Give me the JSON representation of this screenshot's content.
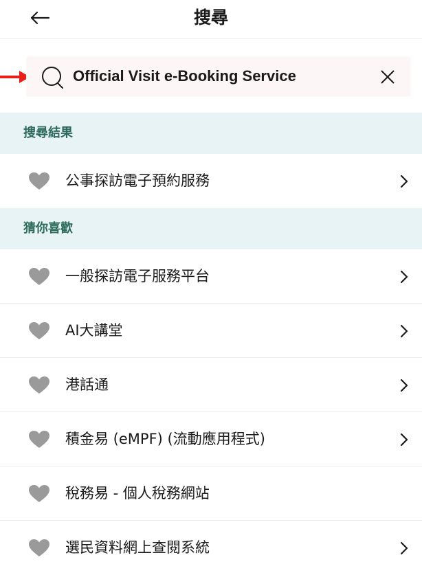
{
  "header": {
    "title": "搜尋"
  },
  "search": {
    "value": "Official Visit e-Booking Service"
  },
  "sections": {
    "results": {
      "title": "搜尋結果",
      "items": [
        {
          "label": "公事探訪電子預約服務"
        }
      ]
    },
    "recommended": {
      "title": "猜你喜歡",
      "items": [
        {
          "label": "一般探訪電子服務平台"
        },
        {
          "label": "AI大講堂"
        },
        {
          "label": "港話通"
        },
        {
          "label": "積金易 (eMPF) (流動應用程式)"
        },
        {
          "label": "稅務易 - 個人稅務網站"
        },
        {
          "label": "選民資料網上查閱系統"
        }
      ]
    }
  },
  "colors": {
    "accent_text": "#2d6b5a",
    "section_bg": "#e8f3f6",
    "heart": "#9a9a9a",
    "pointer_arrow": "#e8201a"
  }
}
